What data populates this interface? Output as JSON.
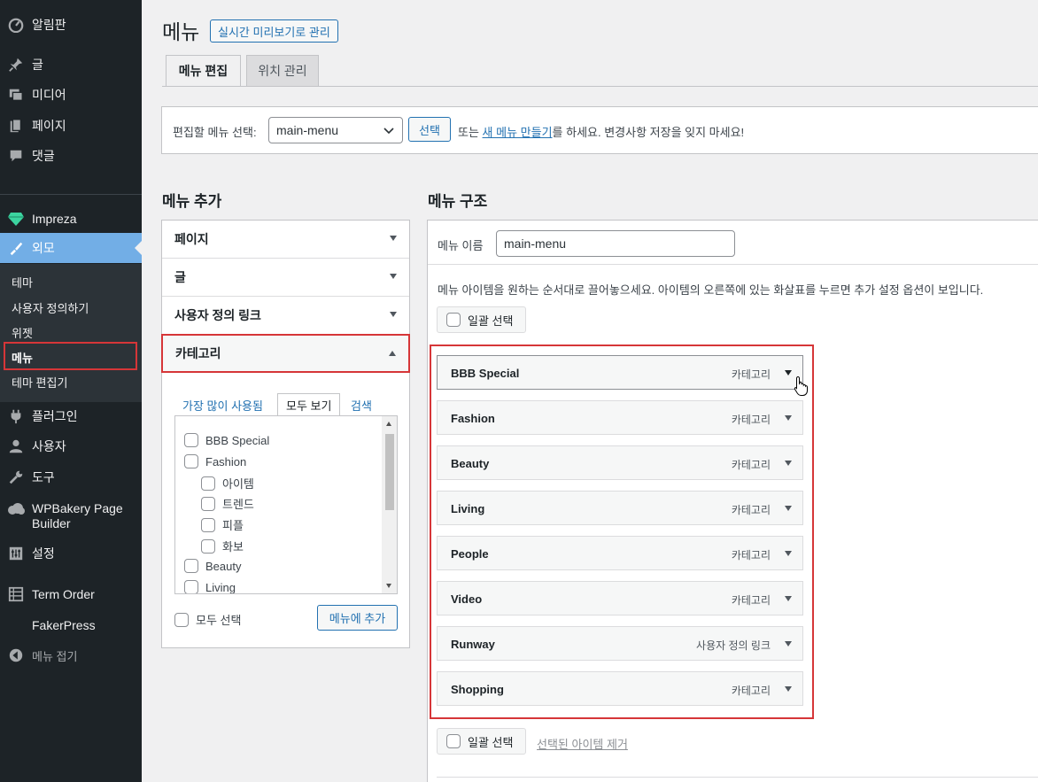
{
  "sidebar": {
    "items": [
      {
        "label": "알림판",
        "icon": "dashboard-icon"
      },
      {
        "label": "글",
        "icon": "pin-icon"
      },
      {
        "label": "미디어",
        "icon": "media-icon"
      },
      {
        "label": "페이지",
        "icon": "page-icon"
      },
      {
        "label": "댓글",
        "icon": "comment-icon"
      },
      {
        "label": "Impreza",
        "icon": "gem-icon"
      },
      {
        "label": "외모",
        "icon": "brush-icon"
      },
      {
        "label": "플러그인",
        "icon": "plugin-icon"
      },
      {
        "label": "사용자",
        "icon": "user-icon"
      },
      {
        "label": "도구",
        "icon": "wrench-icon"
      },
      {
        "label": "WPBakery Page",
        "label2": "Builder",
        "icon": "cloud-icon"
      },
      {
        "label": "설정",
        "icon": "settings-icon"
      },
      {
        "label": "Term Order",
        "icon": "list-icon"
      },
      {
        "label": "FakerPress",
        "icon": ""
      },
      {
        "label": "메뉴 접기",
        "icon": "collapse-icon"
      }
    ],
    "submenu": [
      "테마",
      "사용자 정의하기",
      "위젯",
      "메뉴",
      "테마 편집기"
    ]
  },
  "header": {
    "title": "메뉴",
    "live_button": "실시간 미리보기로 관리",
    "tabs": [
      "메뉴 편집",
      "위치 관리"
    ]
  },
  "select_bar": {
    "label": "편집할 메뉴 선택:",
    "selected": "main-menu",
    "button": "선택",
    "text_before": "또는 ",
    "link": "새 메뉴 만들기",
    "text_after": "를 하세요. 변경사항 저장을 잊지 마세요!"
  },
  "add_menu": {
    "heading": "메뉴 추가",
    "sections": [
      "페이지",
      "글",
      "사용자 정의 링크",
      "카테고리"
    ],
    "category_tabs": [
      "가장 많이 사용됨",
      "모두 보기",
      "검색"
    ],
    "categories": [
      {
        "name": "BBB Special",
        "level": 0
      },
      {
        "name": "Fashion",
        "level": 0
      },
      {
        "name": "아이템",
        "level": 1
      },
      {
        "name": "트렌드",
        "level": 1
      },
      {
        "name": "피플",
        "level": 1
      },
      {
        "name": "화보",
        "level": 1
      },
      {
        "name": "Beauty",
        "level": 0
      },
      {
        "name": "Living",
        "level": 0
      }
    ],
    "select_all": "모두 선택",
    "add_button": "메뉴에 추가"
  },
  "structure": {
    "heading": "메뉴 구조",
    "name_label": "메뉴 이름",
    "name_value": "main-menu",
    "instructions": "메뉴 아이템을 원하는 순서대로 끌어놓으세요. 아이템의 오른쪽에 있는 화살표를 누르면 추가 설정 옵션이 보입니다.",
    "bulk_select": "일괄 선택",
    "remove_selected": "선택된 아이템 제거",
    "items": [
      {
        "title": "BBB Special",
        "type": "카테고리"
      },
      {
        "title": "Fashion",
        "type": "카테고리"
      },
      {
        "title": "Beauty",
        "type": "카테고리"
      },
      {
        "title": "Living",
        "type": "카테고리"
      },
      {
        "title": "People",
        "type": "카테고리"
      },
      {
        "title": "Video",
        "type": "카테고리"
      },
      {
        "title": "Runway",
        "type": "사용자 정의 링크"
      },
      {
        "title": "Shopping",
        "type": "카테고리"
      }
    ]
  },
  "colors": {
    "sidebar_bg": "#1d2327",
    "accent": "#2271b1",
    "current_menu": "#72aee6",
    "highlight": "#d63638"
  }
}
